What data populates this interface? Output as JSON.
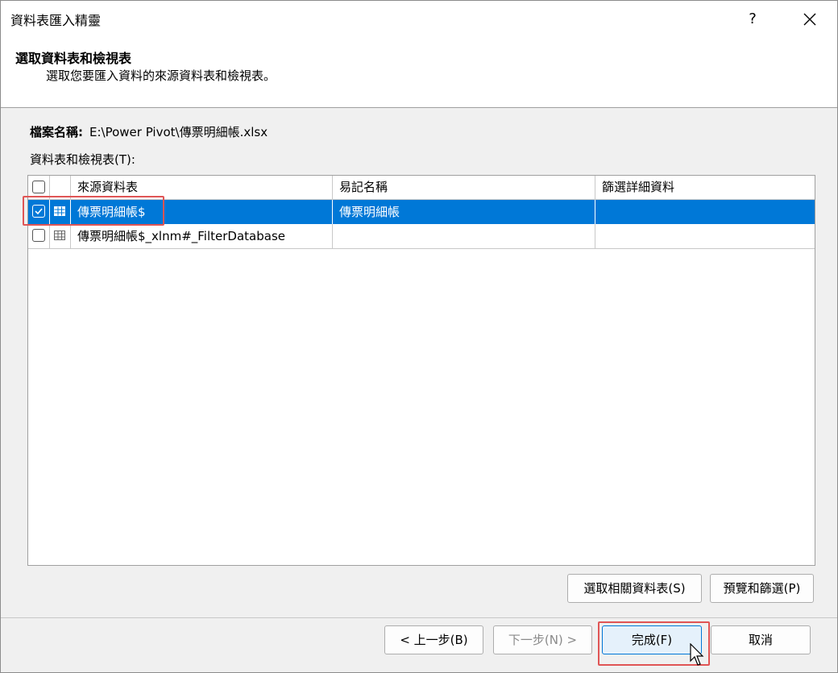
{
  "window": {
    "title": "資料表匯入精靈",
    "help": "?"
  },
  "header": {
    "title": "選取資料表和檢視表",
    "subtitle": "選取您要匯入資料的來源資料表和檢視表。"
  },
  "file": {
    "label": "檔案名稱:",
    "value": "E:\\Power Pivot\\傳票明細帳.xlsx"
  },
  "list_label": "資料表和檢視表(T):",
  "table": {
    "columns": [
      "來源資料表",
      "易記名稱",
      "篩選詳細資料"
    ],
    "rows": [
      {
        "source": "傳票明細帳$",
        "friendly": "傳票明細帳",
        "filter": "",
        "checked": true,
        "selected": true
      },
      {
        "source": "傳票明細帳$_xlnm#_FilterDatabase",
        "friendly": "",
        "filter": "",
        "checked": false,
        "selected": false
      }
    ]
  },
  "buttons": {
    "select_related": "選取相關資料表(S)",
    "preview_filter": "預覽和篩選(P)",
    "back": "< 上一步(B)",
    "next": "下一步(N) >",
    "finish": "完成(F)",
    "cancel": "取消"
  },
  "colors": {
    "selection": "#0078d7",
    "highlight_box": "#e05555"
  }
}
